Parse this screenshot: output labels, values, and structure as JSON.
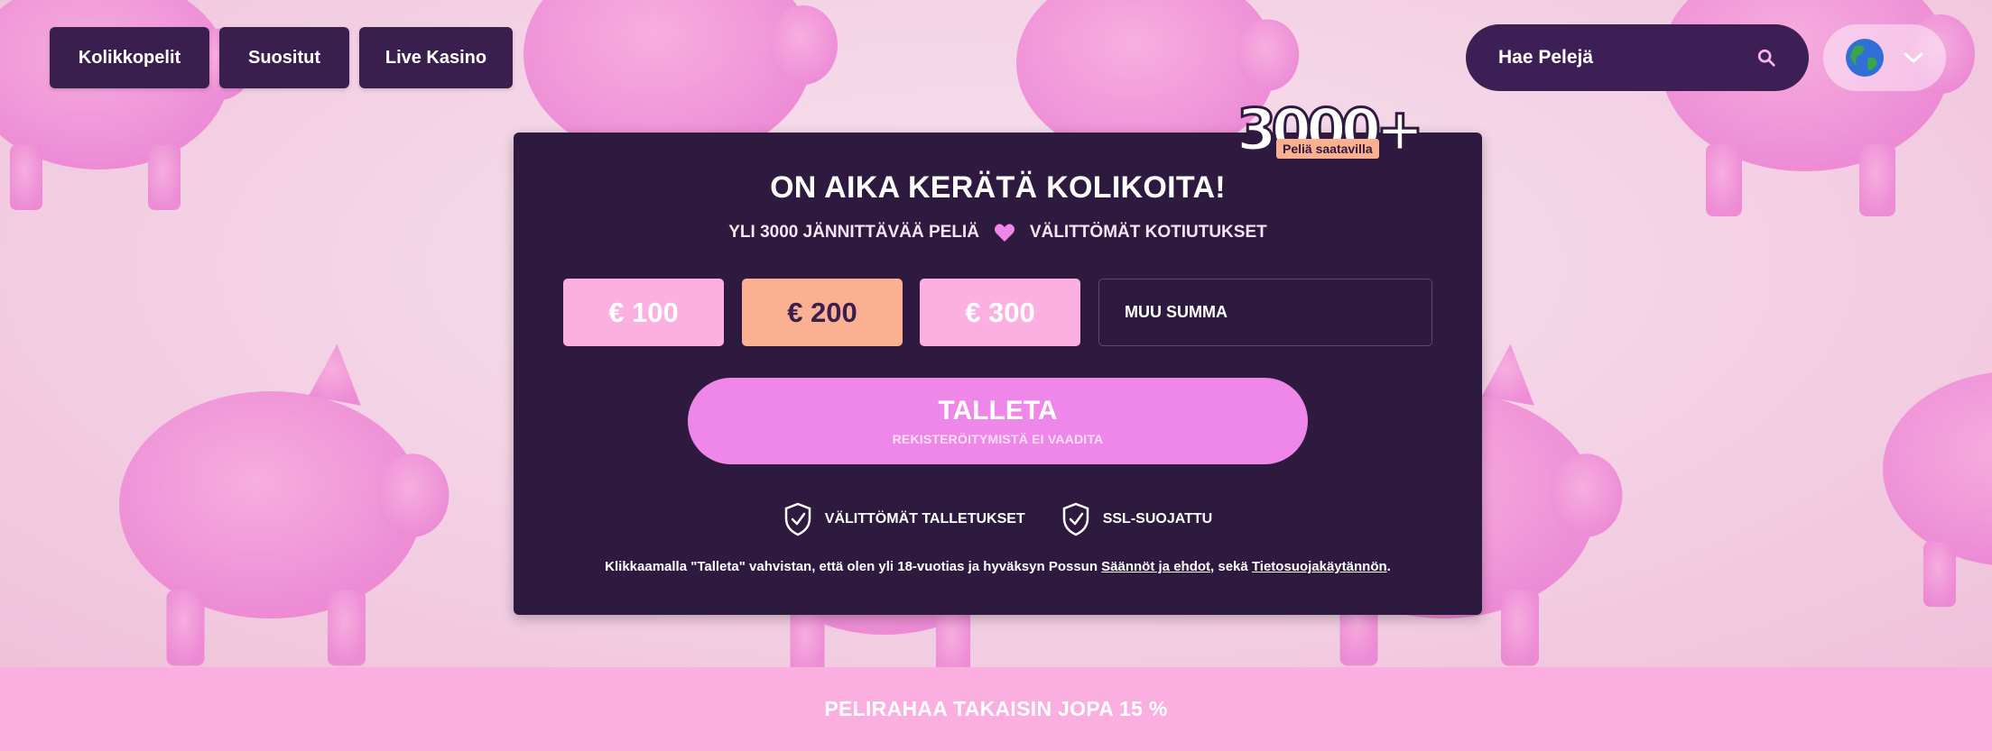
{
  "nav": {
    "items": [
      {
        "label": "Kolikkopelit"
      },
      {
        "label": "Suositut"
      },
      {
        "label": "Live Kasino"
      }
    ]
  },
  "search": {
    "placeholder": "Hae Pelejä",
    "icon": "search-icon"
  },
  "language": {
    "icon": "globe-icon",
    "dropdown_icon": "chevron-down-icon"
  },
  "badge": {
    "number": "3000+",
    "label": "Peliä saatavilla"
  },
  "card": {
    "title": "ON AIKA KERÄTÄ KOLIKOITA!",
    "subtitle_left": "YLI 3000 JÄNNITTÄVÄÄ PELIÄ",
    "subtitle_right": "VÄLITTÖMÄT KOTIUTUKSET",
    "amounts": [
      "€ 100",
      "€ 200",
      "€ 300"
    ],
    "selected_amount": "€ 200",
    "other_amount_placeholder": "MUU SUMMA",
    "deposit_label": "TALLETA",
    "deposit_sublabel": "REKISTERÖITYMISTÄ EI VAADITA",
    "trust": [
      "VÄLITTÖMÄT TALLETUKSET",
      "SSL-SUOJATTU"
    ],
    "legal": {
      "prefix": "Klikkaamalla \"Talleta\" vahvistan, että olen yli 18-vuotias ja hyväksyn Possun ",
      "terms_link": "Säännöt ja ehdot",
      "middle": ", sekä ",
      "privacy_link": "Tietosuojakäytännön",
      "suffix": "."
    }
  },
  "bottom_bar": {
    "text": "PELIRAHAA TAKAISIN JOPA 15 %"
  },
  "colors": {
    "dark_purple": "#2e1a3e",
    "nav_purple": "#3a1f4e",
    "pink": "#ef86ea",
    "light_pink": "#fbb0e1",
    "peach": "#fbb091"
  }
}
